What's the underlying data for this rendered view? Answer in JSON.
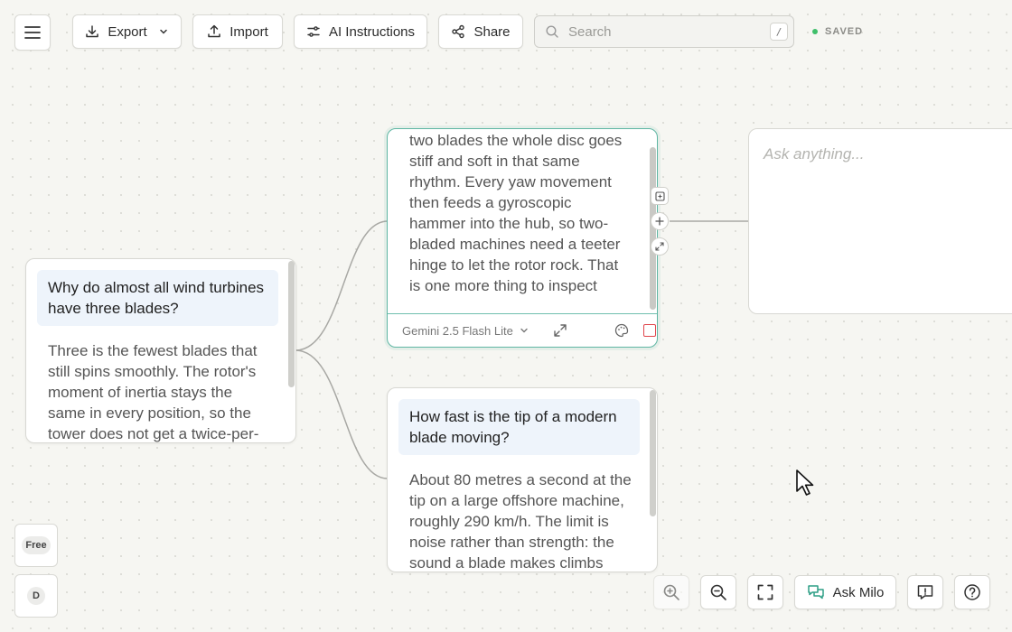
{
  "toolbar": {
    "export_label": "Export",
    "import_label": "Import",
    "ai_instructions_label": "AI Instructions",
    "share_label": "Share",
    "search_placeholder": "Search",
    "search_shortcut": "/",
    "status": "SAVED"
  },
  "nodes": {
    "root": {
      "question": "Why do almost all wind turbines have three blades?",
      "answer": "Three is the fewest blades that still spins smoothly. The rotor's moment of inertia stays the same in every position, so the tower does not get a twice-per-"
    },
    "active": {
      "answer": "two blades the whole disc goes stiff and soft in that same rhythm. Every yaw movement then feeds a gyroscopic hammer into the hub, so two-bladed machines need a teeter hinge to let the rotor rock. That is one more thing to inspect offshore, and the blades hav",
      "model": "Gemini 2.5 Flash Lite"
    },
    "tip": {
      "question": "How fast is the tip of a modern blade moving?",
      "answer": "About 80 metres a second at the tip on a large offshore machine, roughly 290 km/h. The limit is noise rather than strength: the sound a blade makes climbs"
    },
    "ask": {
      "placeholder": "Ask anything..."
    }
  },
  "sidebar": {
    "plan": "Free",
    "avatar": "D"
  },
  "bottom": {
    "ask_milo_label": "Ask Milo"
  },
  "colors": {
    "accent": "#5fb6a3",
    "saved_dot": "#3fbf6a",
    "question_bg": "#eef4fb"
  }
}
